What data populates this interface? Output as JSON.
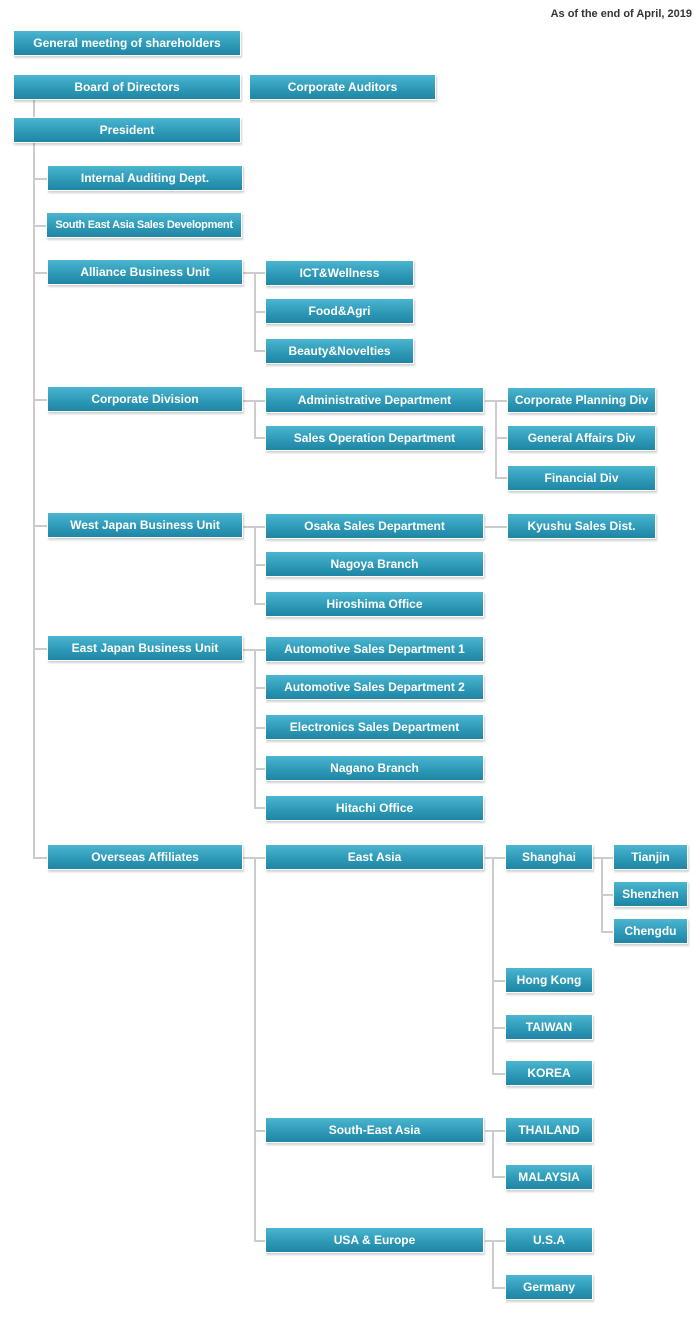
{
  "as_of": "As of the end of April, 2019",
  "colors": {
    "box": "#2e9ab8",
    "box_text": "#ffffff",
    "connector": "#cccccc"
  },
  "top": {
    "shareholders": "General meeting of shareholders",
    "board": "Board of Directors",
    "auditors": "Corporate Auditors",
    "president": "President"
  },
  "units": {
    "internal_audit": "Internal Auditing Dept.",
    "sea_sales_dev": "South East Asia Sales Development",
    "alliance": {
      "label": "Alliance Business Unit",
      "children": [
        "ICT&Wellness",
        "Food&Agri",
        "Beauty&Novelties"
      ]
    },
    "corporate": {
      "label": "Corporate Division",
      "admin": "Administrative Department",
      "admin_children": [
        "Corporate Planning Div",
        "General Affairs Div",
        "Financial Div"
      ],
      "sales_op": "Sales Operation Department"
    },
    "west": {
      "label": "West Japan Business Unit",
      "osaka": "Osaka Sales Department",
      "osaka_children": [
        "Kyushu Sales Dist."
      ],
      "nagoya": "Nagoya Branch",
      "hiroshima": "Hiroshima Office"
    },
    "east": {
      "label": "East Japan Business Unit",
      "children": [
        "Automotive Sales Department 1",
        "Automotive Sales Department 2",
        "Electronics Sales Department",
        "Nagano Branch",
        "Hitachi Office"
      ]
    },
    "overseas": {
      "label": "Overseas Affiliates",
      "east_asia": "East Asia",
      "shanghai": "Shanghai",
      "shanghai_children": [
        "Tianjin",
        "Shenzhen",
        "Chengdu"
      ],
      "east_asia_children": [
        "Hong Kong",
        "TAIWAN",
        "KOREA"
      ],
      "sea": "South-East Asia",
      "sea_children": [
        "THAILAND",
        "MALAYSIA"
      ],
      "usa_europe": "USA & Europe",
      "usa_europe_children": [
        "U.S.A",
        "Germany"
      ]
    }
  }
}
